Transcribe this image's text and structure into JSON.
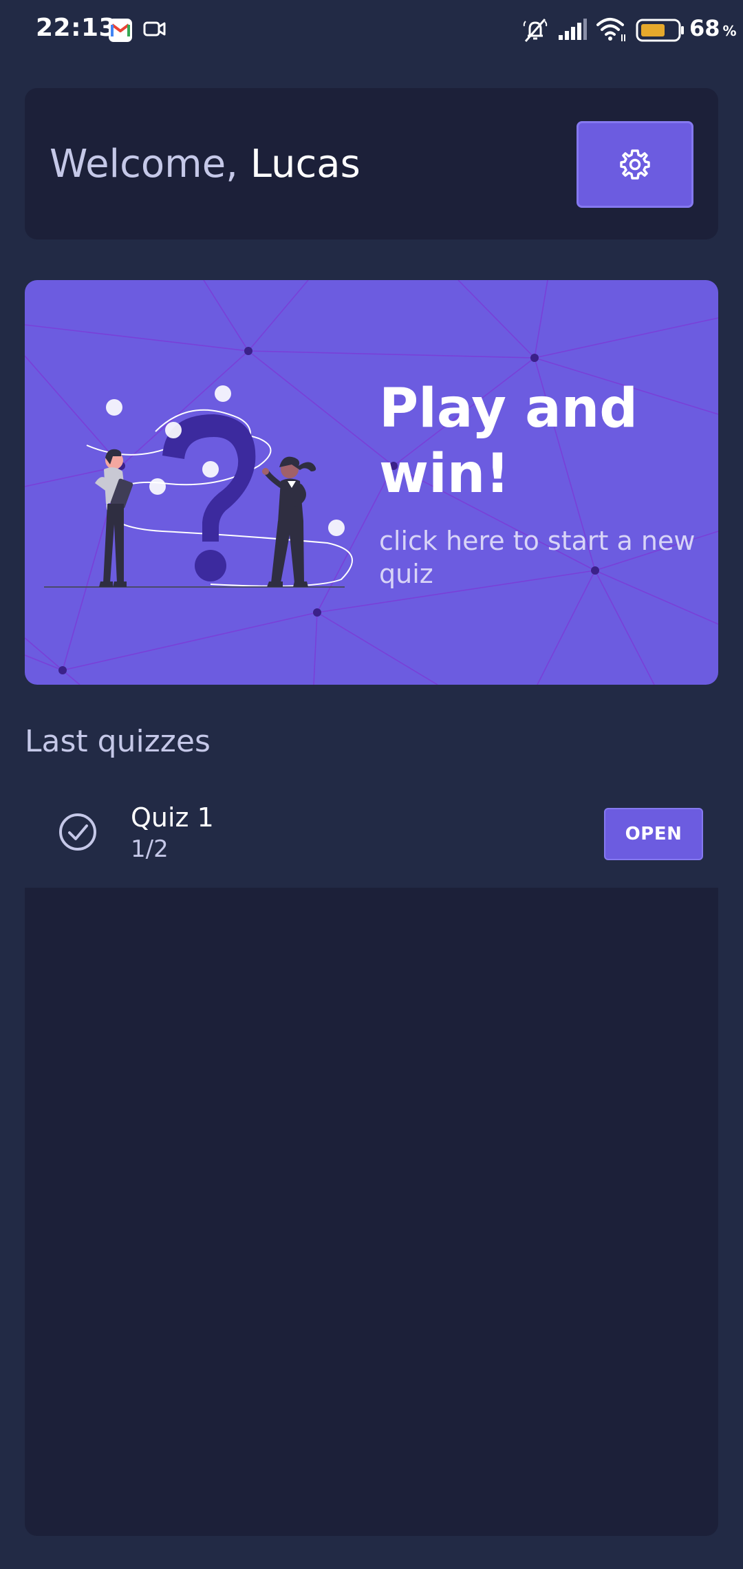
{
  "status_bar": {
    "time": "22:13",
    "battery": "68",
    "battery_unit": "%",
    "icons": [
      "gmail-icon",
      "video-icon",
      "mute-icon",
      "signal-icon",
      "wifi-icon",
      "battery-icon"
    ]
  },
  "welcome": {
    "greeting": "Welcome, ",
    "name": "Lucas",
    "settings_icon": "gear-icon"
  },
  "hero": {
    "title": "Play and win!",
    "subtitle": "click here to start a new quiz"
  },
  "last_quizzes": {
    "title": "Last quizzes",
    "items": [
      {
        "name": "Quiz 1",
        "score": "1/2",
        "status_icon": "check-circle-icon",
        "action_label": "OPEN"
      }
    ]
  },
  "colors": {
    "background": "#222a45",
    "card": "#1c2039",
    "accent": "#6c5ce0",
    "text_muted": "#c5c8e8"
  }
}
